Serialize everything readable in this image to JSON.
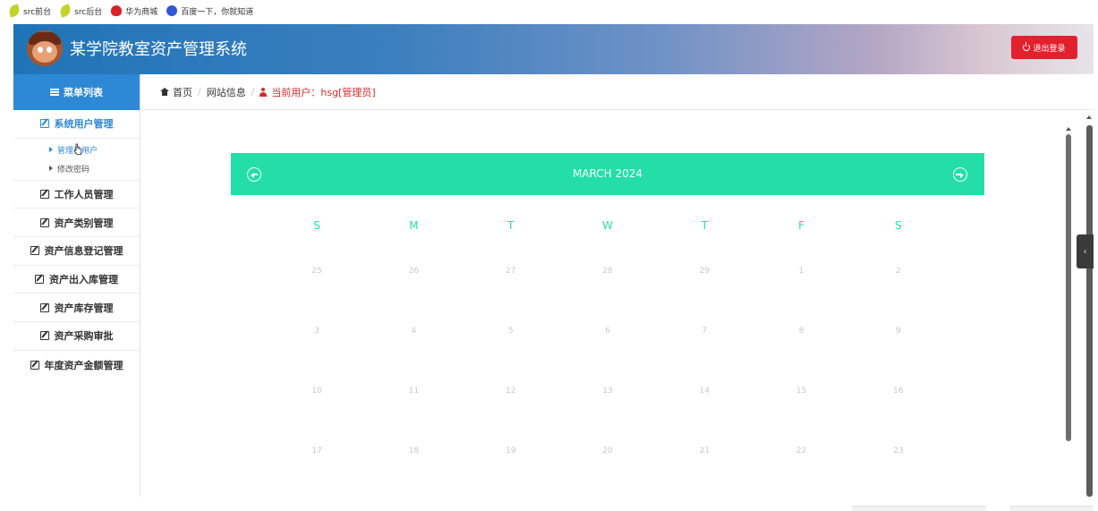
{
  "bookmarks": [
    {
      "label": "src前台",
      "icon": "leaf-icon"
    },
    {
      "label": "src后台",
      "icon": "leaf-icon"
    },
    {
      "label": "华为商城",
      "icon": "huawei-icon"
    },
    {
      "label": "百度一下，你就知道",
      "icon": "baidu-icon"
    }
  ],
  "header": {
    "title": "某学院教室资产管理系统",
    "logout": "退出登录"
  },
  "sidebar": {
    "title": "菜单列表",
    "items": [
      {
        "label": "系统用户管理"
      },
      {
        "label": "工作人员管理"
      },
      {
        "label": "资产类别管理"
      },
      {
        "label": "资产信息登记管理"
      },
      {
        "label": "资产出入库管理"
      },
      {
        "label": "资产库存管理"
      },
      {
        "label": "资产采购审批"
      },
      {
        "label": "年度资产金额管理"
      }
    ],
    "subitems": [
      {
        "label": "管理员用户"
      },
      {
        "label": "修改密码"
      }
    ]
  },
  "breadcrumb": {
    "home": "首页",
    "site": "网站信息",
    "current_user": "当前用户：hsg[管理员]"
  },
  "calendar": {
    "month": "MARCH 2024",
    "weekdays": [
      "S",
      "M",
      "T",
      "W",
      "T",
      "F",
      "S"
    ],
    "weeks": [
      [
        "25",
        "26",
        "27",
        "28",
        "29",
        "1",
        "2"
      ],
      [
        "3",
        "4",
        "5",
        "6",
        "7",
        "8",
        "9"
      ],
      [
        "10",
        "11",
        "12",
        "13",
        "14",
        "15",
        "16"
      ],
      [
        "17",
        "18",
        "19",
        "20",
        "21",
        "22",
        "23"
      ]
    ]
  },
  "colors": {
    "accent": "#2d88d6",
    "calendar": "#23dfa7",
    "danger": "#e3202d"
  }
}
